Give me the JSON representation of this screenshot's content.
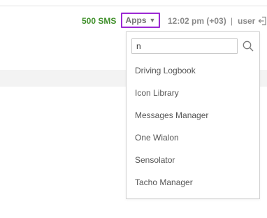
{
  "topbar": {
    "sms_label": "500 SMS",
    "apps_label": "Apps",
    "clock": "12:02 pm (+03)",
    "separator": "|",
    "user": "user"
  },
  "apps_menu": {
    "search_value": "n",
    "items": [
      {
        "label": "Driving Logbook"
      },
      {
        "label": "Icon Library"
      },
      {
        "label": "Messages Manager"
      },
      {
        "label": "One Wialon"
      },
      {
        "label": "Sensolator"
      },
      {
        "label": "Tacho Manager"
      }
    ]
  },
  "colors": {
    "sms_green": "#3f8f2a",
    "apps_border_purple": "#9b29d3",
    "muted_gray": "#8a8a8a"
  },
  "icons": [
    "chevron-down-icon",
    "logout-icon",
    "search-icon"
  ]
}
